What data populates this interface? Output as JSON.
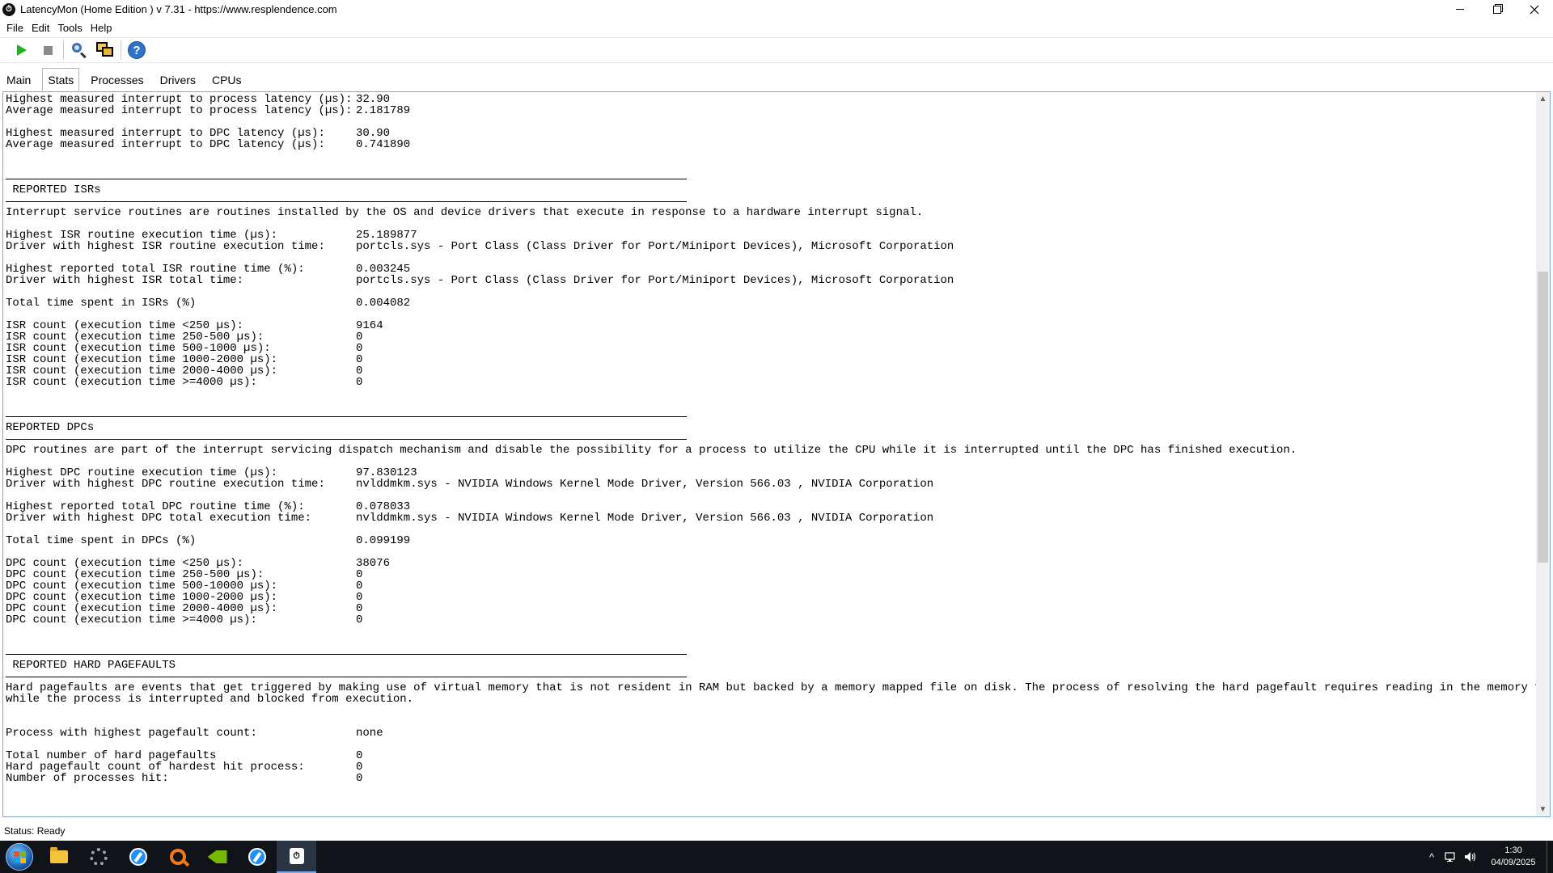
{
  "window": {
    "title": "LatencyMon  (Home Edition )  v 7.31 - https://www.resplendence.com",
    "app_icon_glyph": "⏱"
  },
  "menu": [
    {
      "name": "menu-file",
      "label": "File"
    },
    {
      "name": "menu-edit",
      "label": "Edit"
    },
    {
      "name": "menu-tools",
      "label": "Tools"
    },
    {
      "name": "menu-help",
      "label": "Help"
    }
  ],
  "toolbar": {
    "help_glyph": "?"
  },
  "tabs": [
    {
      "name": "tab-main",
      "label": "Main",
      "active": false
    },
    {
      "name": "tab-stats",
      "label": "Stats",
      "active": true
    },
    {
      "name": "tab-processes",
      "label": "Processes",
      "active": false
    },
    {
      "name": "tab-drivers",
      "label": "Drivers",
      "active": false
    },
    {
      "name": "tab-cpus",
      "label": "CPUs",
      "active": false
    }
  ],
  "report": [
    {
      "k": "Highest measured interrupt to process latency (µs):",
      "v": "32.90"
    },
    {
      "k": "Average measured interrupt to process latency (µs):",
      "v": "2.181789"
    },
    {
      "blank": true
    },
    {
      "k": "Highest measured interrupt to DPC latency (µs):",
      "v": "30.90"
    },
    {
      "k": "Average measured interrupt to DPC latency (µs):",
      "v": "0.741890"
    },
    {
      "blank": true
    },
    {
      "blank": true
    },
    {
      "sep": true
    },
    {
      "text": " REPORTED ISRs"
    },
    {
      "sep": true
    },
    {
      "text": "Interrupt service routines are routines installed by the OS and device drivers that execute in response to a hardware interrupt signal."
    },
    {
      "blank": true
    },
    {
      "k": "Highest ISR routine execution time (µs):",
      "v": "25.189877"
    },
    {
      "k": "Driver with highest ISR routine execution time:",
      "v": "portcls.sys - Port Class (Class Driver for Port/Miniport Devices), Microsoft Corporation"
    },
    {
      "blank": true
    },
    {
      "k": "Highest reported total ISR routine time (%):",
      "v": "0.003245"
    },
    {
      "k": "Driver with highest ISR total time:",
      "v": "portcls.sys - Port Class (Class Driver for Port/Miniport Devices), Microsoft Corporation"
    },
    {
      "blank": true
    },
    {
      "k": "Total time spent in ISRs (%)",
      "v": "0.004082"
    },
    {
      "blank": true
    },
    {
      "k": "ISR count (execution time <250 µs):",
      "v": "9164"
    },
    {
      "k": "ISR count (execution time 250-500 µs):",
      "v": "0"
    },
    {
      "k": "ISR count (execution time 500-1000 µs):",
      "v": "0"
    },
    {
      "k": "ISR count (execution time 1000-2000 µs):",
      "v": "0"
    },
    {
      "k": "ISR count (execution time 2000-4000 µs):",
      "v": "0"
    },
    {
      "k": "ISR count (execution time >=4000 µs):",
      "v": "0"
    },
    {
      "blank": true
    },
    {
      "blank": true
    },
    {
      "sep": true
    },
    {
      "text": "REPORTED DPCs"
    },
    {
      "sep": true
    },
    {
      "text": "DPC routines are part of the interrupt servicing dispatch mechanism and disable the possibility for a process to utilize the CPU while it is interrupted until the DPC has finished execution."
    },
    {
      "blank": true
    },
    {
      "k": "Highest DPC routine execution time (µs):",
      "v": "97.830123"
    },
    {
      "k": "Driver with highest DPC routine execution time:",
      "v": "nvlddmkm.sys - NVIDIA Windows Kernel Mode Driver, Version 566.03 , NVIDIA Corporation"
    },
    {
      "blank": true
    },
    {
      "k": "Highest reported total DPC routine time (%):",
      "v": "0.078033"
    },
    {
      "k": "Driver with highest DPC total execution time:",
      "v": "nvlddmkm.sys - NVIDIA Windows Kernel Mode Driver, Version 566.03 , NVIDIA Corporation"
    },
    {
      "blank": true
    },
    {
      "k": "Total time spent in DPCs (%)",
      "v": "0.099199"
    },
    {
      "blank": true
    },
    {
      "k": "DPC count (execution time <250 µs):",
      "v": "38076"
    },
    {
      "k": "DPC count (execution time 250-500 µs):",
      "v": "0"
    },
    {
      "k": "DPC count (execution time 500-10000 µs):",
      "v": "0"
    },
    {
      "k": "DPC count (execution time 1000-2000 µs):",
      "v": "0"
    },
    {
      "k": "DPC count (execution time 2000-4000 µs):",
      "v": "0"
    },
    {
      "k": "DPC count (execution time >=4000 µs):",
      "v": "0"
    },
    {
      "blank": true
    },
    {
      "blank": true
    },
    {
      "sep": true
    },
    {
      "text": " REPORTED HARD PAGEFAULTS"
    },
    {
      "sep": true
    },
    {
      "text": "Hard pagefaults are events that get triggered by making use of virtual memory that is not resident in RAM but backed by a memory mapped file on disk. The process of resolving the hard pagefault requires reading in the memory from disk"
    },
    {
      "text": "while the process is interrupted and blocked from execution."
    },
    {
      "blank": true
    },
    {
      "blank": true
    },
    {
      "k": "Process with highest pagefault count:",
      "v": "none"
    },
    {
      "blank": true
    },
    {
      "k": "Total number of hard pagefaults",
      "v": "0"
    },
    {
      "k": "Hard pagefault count of hardest hit process:",
      "v": "0"
    },
    {
      "k": "Number of processes hit:",
      "v": "0"
    }
  ],
  "scrollbar": {
    "up_glyph": "▲",
    "down_glyph": "▼"
  },
  "status": {
    "text": "Status: Ready"
  },
  "taskbar": {
    "latency_glyph": "⏱",
    "tray_up_glyph": "^",
    "clock_time": "1:30",
    "clock_date": "04/09/2025"
  }
}
